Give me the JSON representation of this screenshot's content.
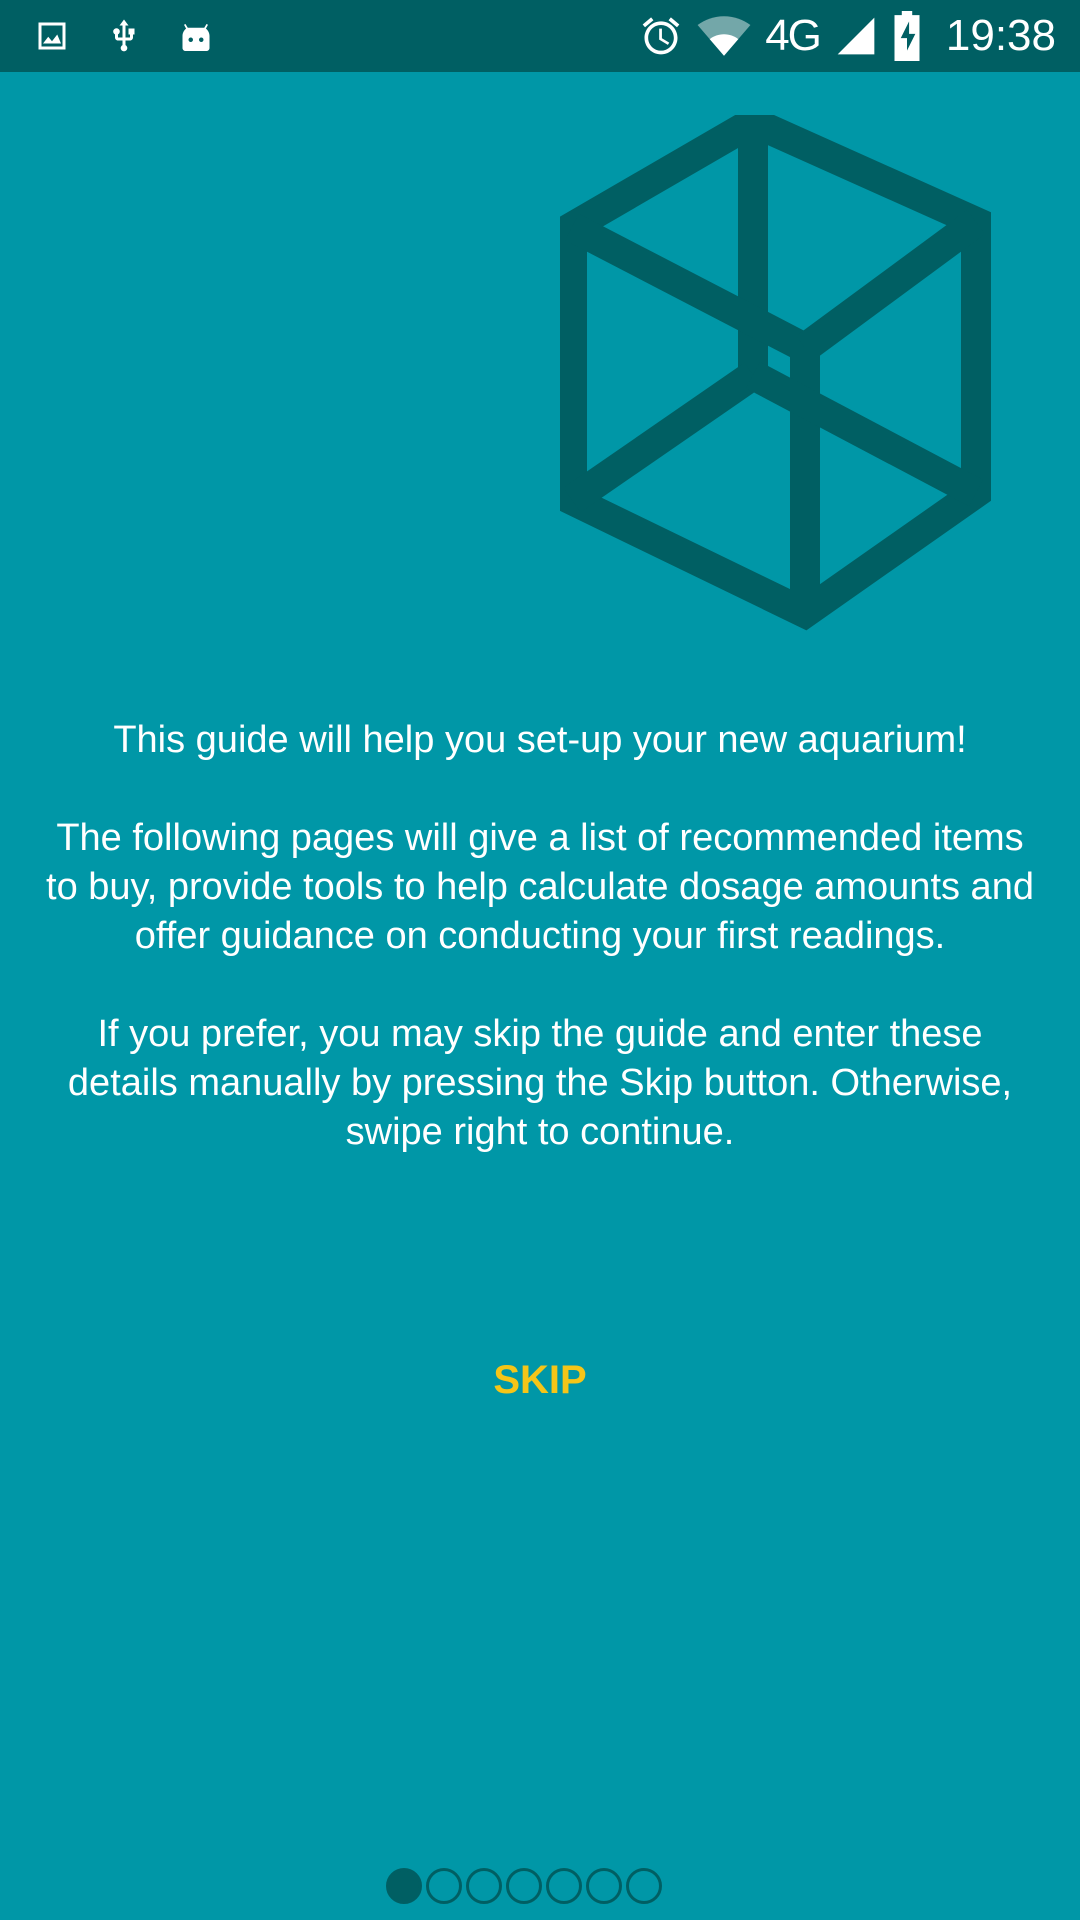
{
  "status_bar": {
    "left_icons": [
      "image-icon",
      "usb-icon",
      "android-icon"
    ],
    "right_icons": [
      "alarm-icon",
      "wifi-icon",
      "signal-icon",
      "battery-charging-icon"
    ],
    "network_label": "4G",
    "time": "19:38",
    "background_color": "#005F63"
  },
  "hero": {
    "icon": "cube-icon",
    "color": "#005F63"
  },
  "intro": {
    "paragraph1": "This guide will help you set-up your new aquarium!",
    "paragraph2": "The following pages will give a list of recommended items to buy, provide tools to help calculate dosage amounts and offer guidance on conducting your first readings.",
    "paragraph3": "If you prefer, you may skip the guide and enter these details manually by pressing the Skip button. Otherwise, swipe right to continue."
  },
  "skip_label": "SKIP",
  "pager": {
    "total_pages": 7,
    "current_page": 1
  },
  "colors": {
    "background": "#0097A7",
    "accent": "#F5C518",
    "dark": "#005F63"
  }
}
